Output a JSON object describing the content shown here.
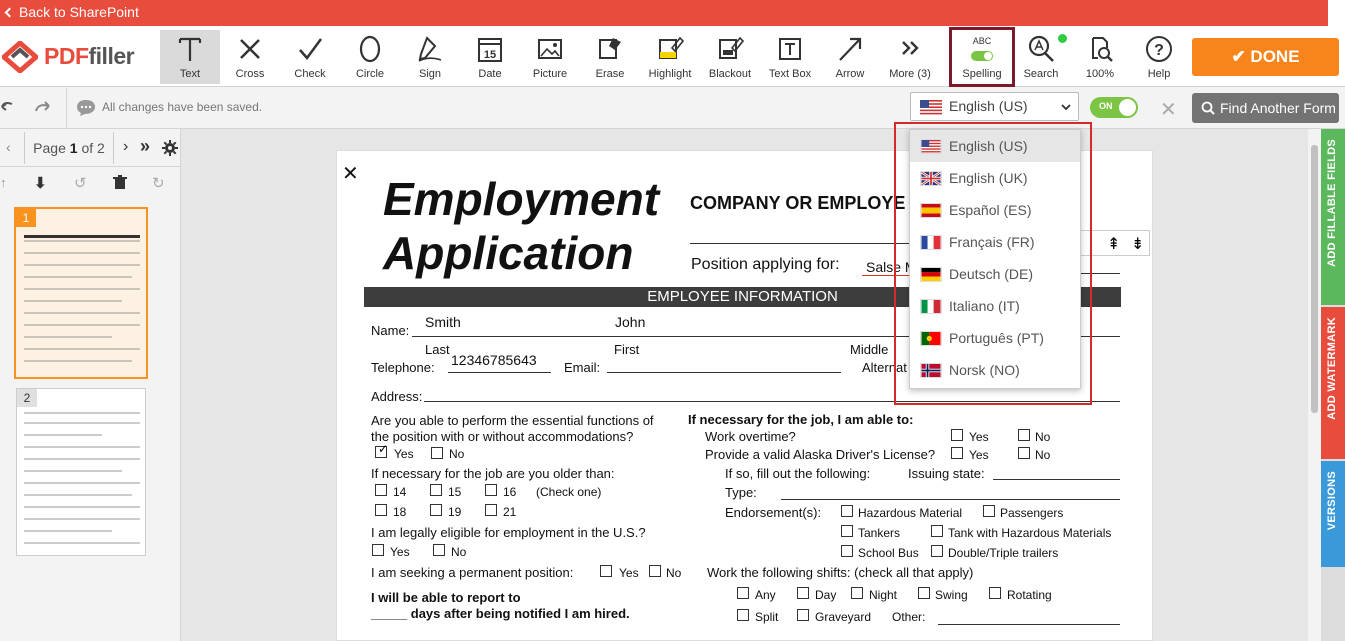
{
  "topbar": {
    "back_label": "Back to SharePoint"
  },
  "logo": {
    "text_a": "PDF",
    "text_b": "filler"
  },
  "tools": [
    {
      "label": "Text",
      "icon": "text-icon"
    },
    {
      "label": "Cross",
      "icon": "cross-icon"
    },
    {
      "label": "Check",
      "icon": "check-icon"
    },
    {
      "label": "Circle",
      "icon": "circle-icon"
    },
    {
      "label": "Sign",
      "icon": "sign-icon"
    },
    {
      "label": "Date",
      "icon": "calendar-icon",
      "badge": "15"
    },
    {
      "label": "Picture",
      "icon": "picture-icon"
    },
    {
      "label": "Erase",
      "icon": "eraser-icon"
    },
    {
      "label": "Highlight",
      "icon": "highlight-icon"
    },
    {
      "label": "Blackout",
      "icon": "blackout-icon"
    },
    {
      "label": "Text Box",
      "icon": "textbox-icon"
    },
    {
      "label": "Arrow",
      "icon": "arrow-icon"
    },
    {
      "label": "More (3)",
      "icon": "more-icon"
    }
  ],
  "spelling": {
    "label": "Spelling",
    "badge": "ABC"
  },
  "search": {
    "label": "Search"
  },
  "zoom": {
    "label": "100%"
  },
  "help": {
    "label": "Help"
  },
  "done": {
    "label": "DONE"
  },
  "status": {
    "saved": "All changes have been saved."
  },
  "language": {
    "selected": "English (US)",
    "toggle": "ON",
    "options": [
      {
        "label": "English (US)",
        "flag": "us"
      },
      {
        "label": "English (UK)",
        "flag": "uk"
      },
      {
        "label": "Español (ES)",
        "flag": "es"
      },
      {
        "label": "Français (FR)",
        "flag": "fr"
      },
      {
        "label": "Deutsch (DE)",
        "flag": "de"
      },
      {
        "label": "Italiano (IT)",
        "flag": "it"
      },
      {
        "label": "Português (PT)",
        "flag": "pt"
      },
      {
        "label": "Norsk (NO)",
        "flag": "no"
      }
    ]
  },
  "find_form": {
    "label": "Find Another Form"
  },
  "pager": {
    "prefix": "Page",
    "current": "1",
    "suffix": "of 2"
  },
  "thumbs": [
    {
      "num": "1"
    },
    {
      "num": "2"
    }
  ],
  "side_tabs": [
    {
      "label": "ADD FILLABLE FIELDS",
      "color": "#5cb85c"
    },
    {
      "label": "ADD WATERMARK",
      "color": "#e84c3d"
    },
    {
      "label": "VERSIONS",
      "color": "#3a9ad9"
    }
  ],
  "form": {
    "title1": "Employment",
    "title2": "Application",
    "company": "COMPANY OR EMPLOYE",
    "position_label": "Position applying for:",
    "position_value": "Salse M",
    "section": "EMPLOYEE INFORMATION",
    "name_label": "Name:",
    "last_value": "Smith",
    "first_value": "John",
    "last": "Last",
    "first": "First",
    "middle": "Middle",
    "telephone_label": "Telephone:",
    "telephone_value": "12346785643",
    "email_label": "Email:",
    "alternate": "Alternat",
    "address_label": "Address:",
    "q1a": "Are you able to perform the essential functions of",
    "q1b": "the position with or without accommodations?",
    "yes": "Yes",
    "no": "No",
    "q2": "If necessary for the job are you older than:",
    "ages": [
      "14",
      "15",
      "16",
      "18",
      "19",
      "21"
    ],
    "check_one": "(Check one)",
    "q3": "I am legally eligible for employment in the U.S.?",
    "q4": "I am seeking a permanent position:",
    "q5a": "I will be able to report to",
    "q5b": "_____ days after being notified I am hired.",
    "r_head": "If necessary for the job, I am able to:",
    "r1": "Work overtime?",
    "r2": "Provide a valid Alaska Driver's License?",
    "r3": "If so, fill out the following:",
    "issuing": "Issuing state:",
    "type": "Type:",
    "endorse": "Endorsement(s):",
    "end1": "Hazardous Material",
    "end2": "Passengers",
    "end3": "Tankers",
    "end4": "Tank with Hazardous Materials",
    "end5": "School Bus",
    "end6": "Double/Triple trailers",
    "shifts": "Work the following shifts: (check all that apply)",
    "s1": "Any",
    "s2": "Day",
    "s3": "Night",
    "s4": "Swing",
    "s5": "Rotating",
    "s6": "Split",
    "s7": "Graveyard",
    "other": "Other:"
  }
}
